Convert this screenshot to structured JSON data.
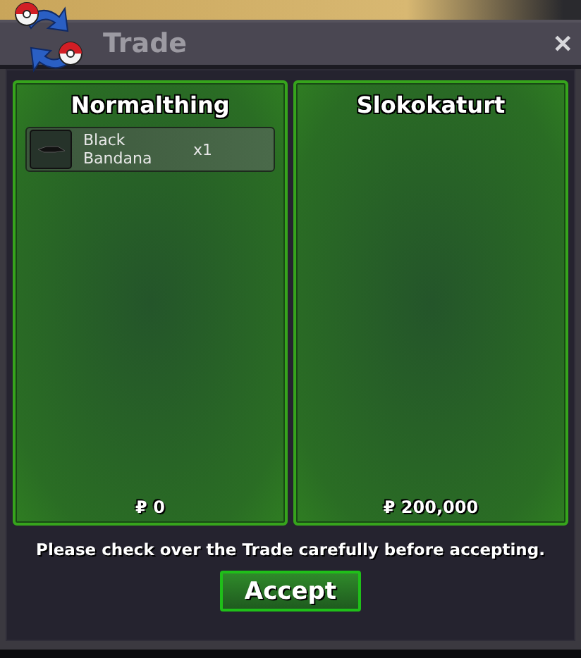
{
  "window": {
    "title": "Trade",
    "close": "✕"
  },
  "panels": [
    {
      "trainer": "Normalthing",
      "items": [
        {
          "name": "Black Bandana",
          "quantity": "x1"
        }
      ],
      "money": "₽ 0"
    },
    {
      "trainer": "Slokokaturt",
      "money": "₽ 200,000"
    }
  ],
  "notice": "Please check over the Trade carefully before accepting.",
  "accept_button": "Accept"
}
